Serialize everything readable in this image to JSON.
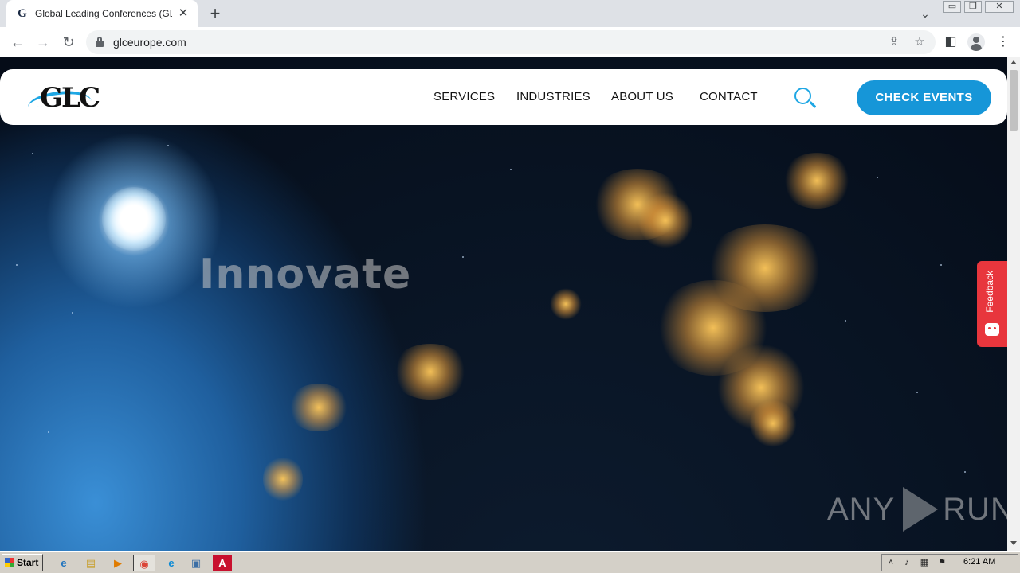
{
  "browser": {
    "tab": {
      "favicon_letter": "G",
      "title": "Global Leading Conferences (GLC) Eu",
      "close_glyph": "✕"
    },
    "new_tab_glyph": "+",
    "tab_search_glyph": "⌄",
    "window_controls": {
      "minimize": "▭",
      "restore": "❐",
      "close": "✕"
    },
    "nav": {
      "back": "←",
      "forward": "→",
      "reload": "↻"
    },
    "address": {
      "url": "glceurope.com"
    },
    "icons": {
      "share": "⇪",
      "bookmark": "☆",
      "sidebar": "◧",
      "menu": "⋮"
    }
  },
  "site": {
    "logo_text": "GLC",
    "nav": [
      {
        "label": "SERVICES"
      },
      {
        "label": "INDUSTRIES"
      },
      {
        "label": "ABOUT US"
      },
      {
        "label": "CONTACT"
      }
    ],
    "cta_label": "CHECK EVENTS",
    "hero_word": "Innovate",
    "feedback_label": "Feedback"
  },
  "watermark": {
    "left": "ANY",
    "right": "RUN"
  },
  "taskbar": {
    "start_label": "Start",
    "apps": [
      {
        "name": "ie",
        "glyph": "e"
      },
      {
        "name": "explorer",
        "glyph": "▤"
      },
      {
        "name": "media",
        "glyph": "▶"
      },
      {
        "name": "chrome",
        "glyph": "◉"
      },
      {
        "name": "edge",
        "glyph": "e"
      },
      {
        "name": "window",
        "glyph": "▣"
      },
      {
        "name": "acrobat",
        "glyph": "A"
      }
    ],
    "tray": {
      "up": "˄",
      "volume": "♪",
      "network": "▦",
      "flag": "⚑",
      "time": "6:21 AM"
    }
  },
  "colors": {
    "accent": "#1696d8",
    "feedback": "#e8363d"
  }
}
